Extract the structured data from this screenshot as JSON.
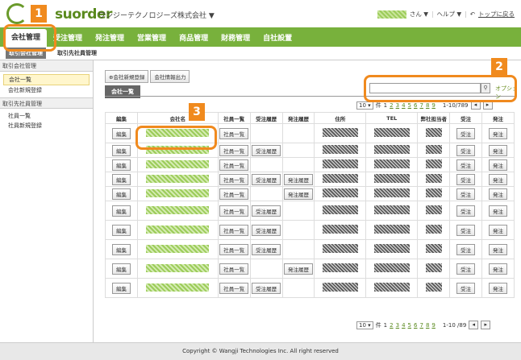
{
  "header": {
    "logo_text": "suorder",
    "company": "ワンジーテクノロジーズ株式会社 ▼",
    "user_suffix": "さん ▼",
    "help": "ヘルプ ▼",
    "top_link": "トップに戻る"
  },
  "mainnav": {
    "tabs": [
      "会社管理",
      "受注管理",
      "発注管理",
      "営業管理",
      "商品管理",
      "財務管理",
      "自社設置"
    ],
    "active": 0
  },
  "subnav": {
    "items": [
      "取引会社管理",
      "取引先社員管理"
    ],
    "active": 0
  },
  "sidebar": {
    "section1": "取引会社管理",
    "section1_items": [
      "会社一覧",
      "会社新規登録"
    ],
    "section2": "取引先社員管理",
    "section2_items": [
      "社員一覧",
      "社員新規登録"
    ]
  },
  "toolbar": {
    "new_label": "会社新規登録",
    "export_label": "会社情報出力"
  },
  "panel": {
    "tab": "会社一覧",
    "option": "オプション",
    "search_value": ""
  },
  "pager": {
    "per_page": "10",
    "unit": "件",
    "pages": [
      "1",
      "2",
      "3",
      "4",
      "5",
      "6",
      "7",
      "8",
      "9"
    ],
    "range_top": "1-10/789",
    "range_bottom": "1-10 /89"
  },
  "table": {
    "headers": [
      "編集",
      "会社名",
      "社員一覧",
      "受注履歴",
      "発注履歴",
      "住所",
      "TEL",
      "弊社担当者",
      "受注",
      "発注"
    ],
    "edit_label": "編集",
    "staff_label": "社員一覧",
    "order_hist_label": "受注履歴",
    "purchase_hist_label": "発注履歴",
    "receive_label": "受注",
    "purchase_label": "発注",
    "rows": [
      {
        "order_hist": false,
        "purchase_hist": false
      },
      {
        "order_hist": true,
        "purchase_hist": false
      },
      {
        "order_hist": false,
        "purchase_hist": false
      },
      {
        "order_hist": true,
        "purchase_hist": true
      },
      {
        "order_hist": false,
        "purchase_hist": true
      },
      {
        "order_hist": true,
        "purchase_hist": false
      },
      {
        "order_hist": true,
        "purchase_hist": false
      },
      {
        "order_hist": true,
        "purchase_hist": false
      },
      {
        "order_hist": false,
        "purchase_hist": true
      },
      {
        "order_hist": true,
        "purchase_hist": false
      }
    ]
  },
  "footer": {
    "copyright": "Copyright © Wangji Technologies Inc. All right reserved"
  },
  "callouts": [
    "1",
    "2",
    "3"
  ],
  "colors": {
    "accent": "#78b13c",
    "callout": "#f08a1e"
  }
}
